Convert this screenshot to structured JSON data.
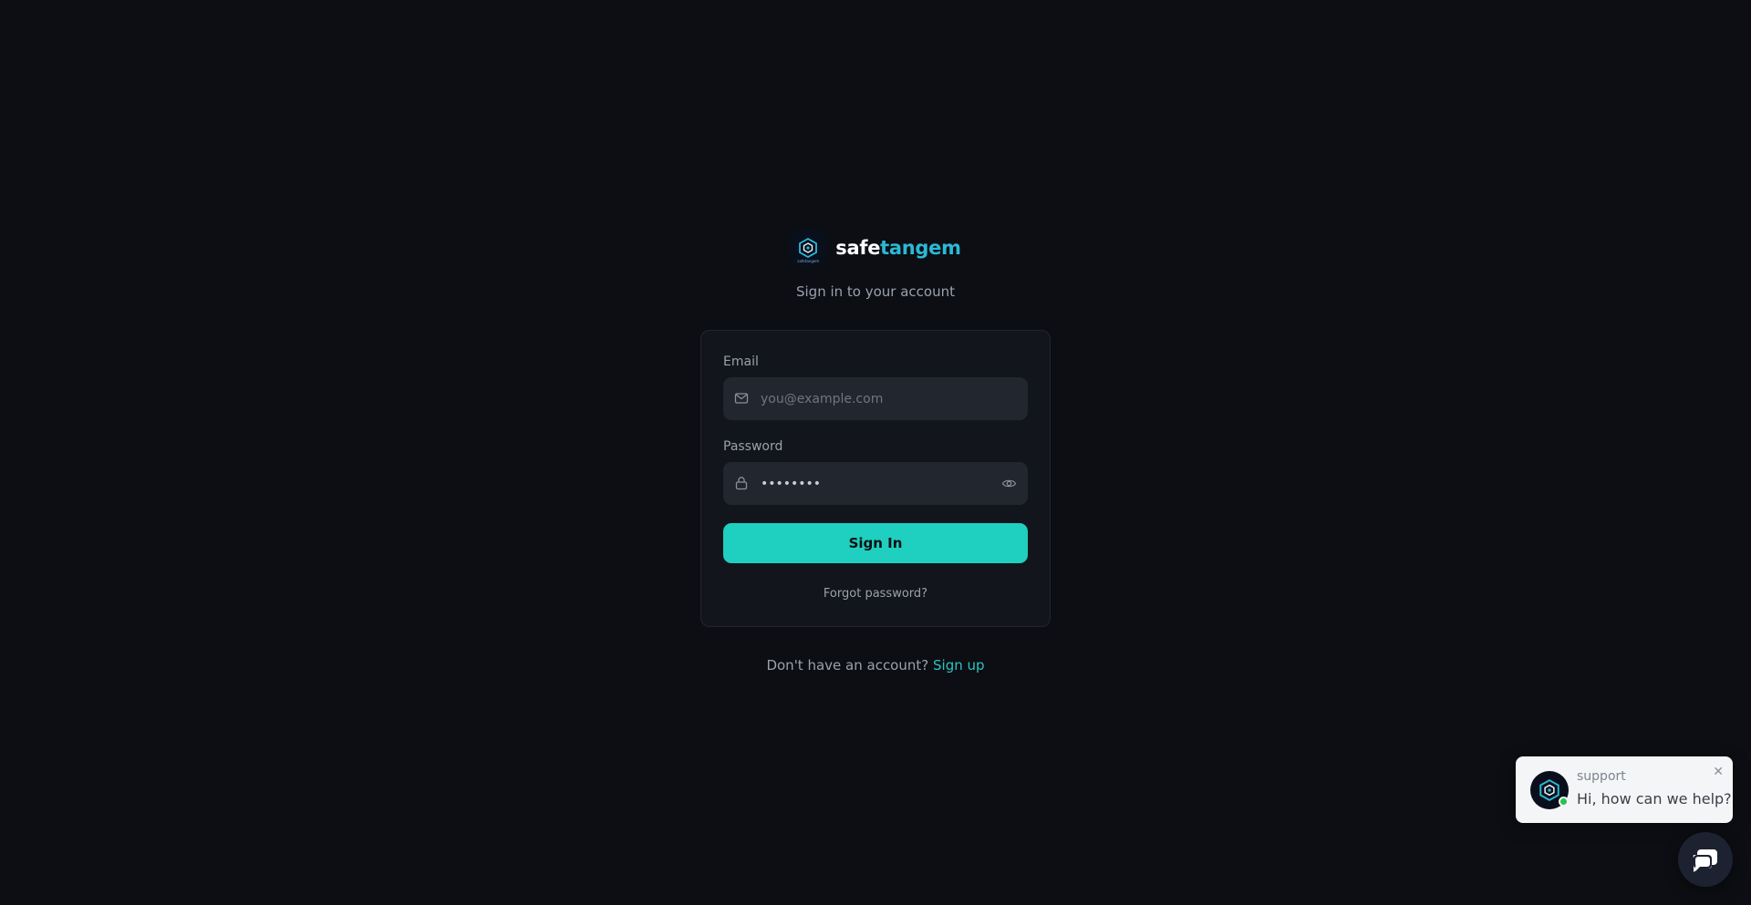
{
  "brand": {
    "name_part1": "safe",
    "name_part2": "tangem",
    "logo_small_text": "safetangem",
    "logo_icon": "hexagon-shield-icon",
    "accent_color": "#2bb9d4"
  },
  "subtitle": "Sign in to your account",
  "form": {
    "email_label": "Email",
    "email_placeholder": "you@example.com",
    "email_icon": "mail-icon",
    "password_label": "Password",
    "password_value": "••••••••",
    "password_icon": "lock-icon",
    "password_toggle_icon": "eye-icon",
    "submit_label": "Sign In",
    "submit_color": "#1fcfbf",
    "forgot_label": "Forgot password?"
  },
  "signup": {
    "prompt": "Don't have an account?",
    "link": "Sign up"
  },
  "chat": {
    "title": "support",
    "message": "Hi, how can we help?",
    "close_glyph": "✕",
    "status_color": "#28c24a",
    "launcher_icon": "chat-icon"
  }
}
